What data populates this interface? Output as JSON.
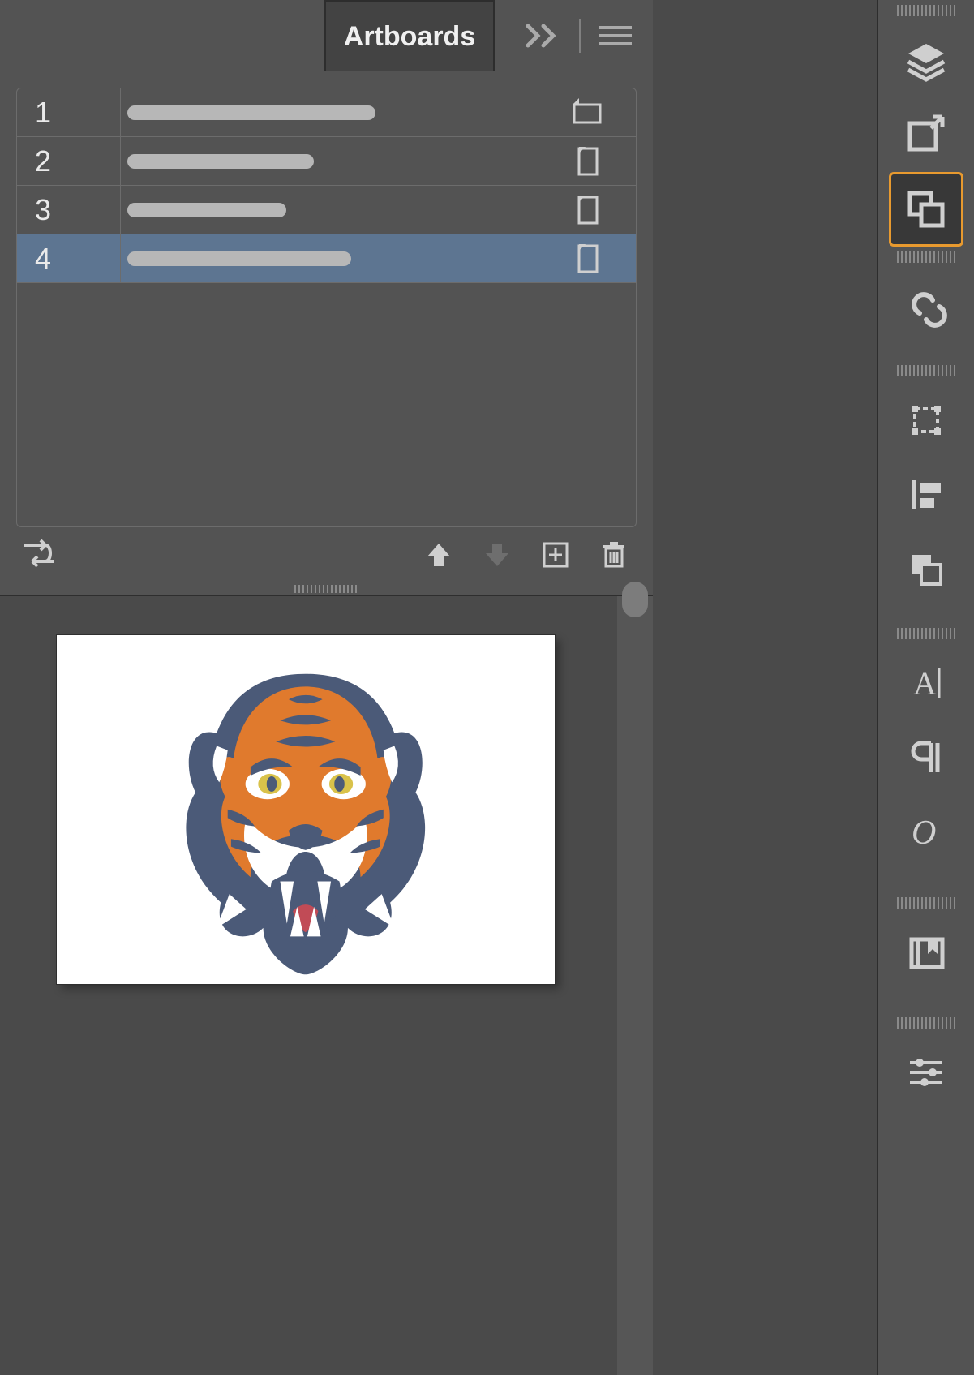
{
  "panel": {
    "tab_label": "Artboards",
    "rows": [
      {
        "index": "1",
        "orientation": "landscape",
        "name_width": 306,
        "selected": false
      },
      {
        "index": "2",
        "orientation": "portrait",
        "name_width": 230,
        "selected": false
      },
      {
        "index": "3",
        "orientation": "portrait",
        "name_width": 196,
        "selected": false
      },
      {
        "index": "4",
        "orientation": "portrait",
        "name_width": 276,
        "selected": true
      }
    ],
    "footer_icons": [
      "rearrange-artboards-icon",
      "move-up-icon",
      "move-down-icon",
      "new-artboard-icon",
      "delete-artboard-icon"
    ],
    "move_down_disabled": true
  },
  "rail_icons": [
    {
      "name": "layers-icon",
      "active": false
    },
    {
      "name": "asset-export-icon",
      "active": false
    },
    {
      "name": "artboards-icon",
      "active": true
    },
    {
      "name": "links-icon",
      "active": false
    },
    {
      "name": "transform-icon",
      "active": false
    },
    {
      "name": "align-icon",
      "active": false
    },
    {
      "name": "pathfinder-icon",
      "active": false
    },
    {
      "name": "character-icon",
      "active": false
    },
    {
      "name": "paragraph-icon",
      "active": false
    },
    {
      "name": "opentype-icon",
      "active": false
    },
    {
      "name": "libraries-icon",
      "active": false
    },
    {
      "name": "properties-icon",
      "active": false
    }
  ],
  "canvas": {
    "artwork_name": "tiger-mascot-illustration"
  }
}
